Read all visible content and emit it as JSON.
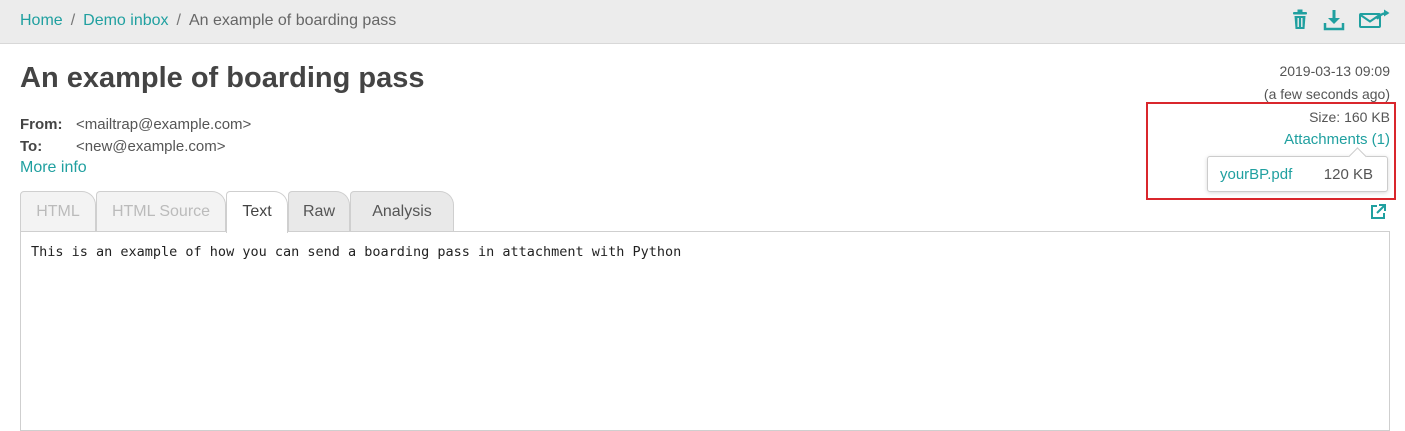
{
  "breadcrumb": {
    "home": "Home",
    "separator": "/",
    "inbox": "Demo inbox",
    "current": "An example of boarding pass"
  },
  "toolbar": {
    "icons": [
      "trash-icon",
      "download-icon",
      "forward-icon"
    ],
    "accent_color": "#20a0a0"
  },
  "message": {
    "subject": "An example of boarding pass",
    "from_label": "From:",
    "from_value": "<mailtrap@example.com>",
    "to_label": "To:",
    "to_value": "<new@example.com>",
    "more_info": "More info",
    "date": "2019-03-13 09:09",
    "relative_time": "(a few seconds ago)",
    "size": "Size: 160 KB",
    "attachments_link": "Attachments (1)"
  },
  "attachments": [
    {
      "name": "yourBP.pdf",
      "size": "120 KB"
    }
  ],
  "highlight_color": "#d9262c",
  "tabs": [
    {
      "label": "HTML",
      "state": "disabled"
    },
    {
      "label": "HTML Source",
      "state": "disabled"
    },
    {
      "label": "Text",
      "state": "active"
    },
    {
      "label": "Raw",
      "state": "normal"
    },
    {
      "label": "Analysis",
      "state": "normal"
    }
  ],
  "body_text": "This is an example of how you can send a boarding pass in attachment with Python"
}
